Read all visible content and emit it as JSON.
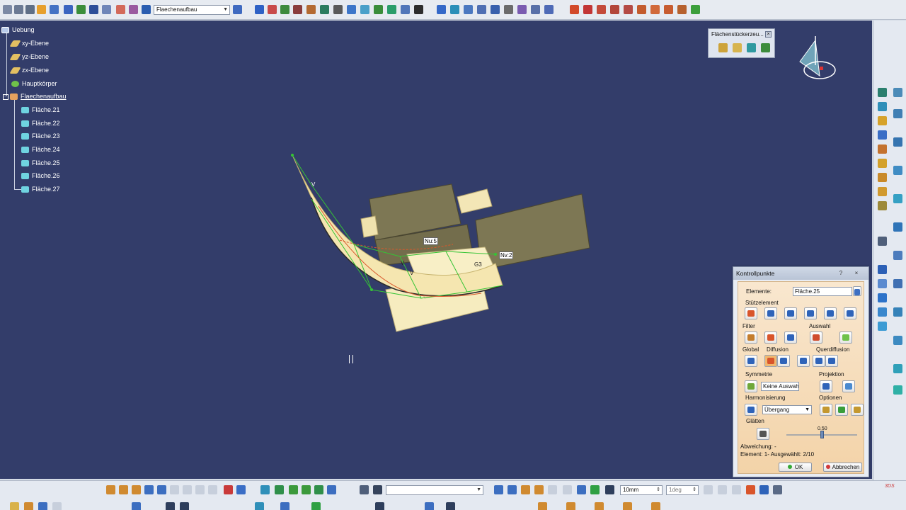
{
  "top_toolbar": {
    "workbench_combo": "Flaechenaufbau"
  },
  "tree": {
    "root": "Uebung",
    "items": [
      {
        "label": "xy-Ebene",
        "icon": "plane-icon"
      },
      {
        "label": "yz-Ebene",
        "icon": "plane-icon"
      },
      {
        "label": "zx-Ebene",
        "icon": "plane-icon"
      },
      {
        "label": "Hauptkörper",
        "icon": "gear-body-icon"
      },
      {
        "label": "Flaechenaufbau",
        "icon": "geometrical-set-icon"
      }
    ],
    "children": [
      {
        "label": "Fläche.21"
      },
      {
        "label": "Fläche.22"
      },
      {
        "label": "Fläche.23"
      },
      {
        "label": "Fläche.24"
      },
      {
        "label": "Fläche.25"
      },
      {
        "label": "Fläche.26"
      },
      {
        "label": "Fläche.27"
      }
    ]
  },
  "floating_toolbar": {
    "title": "Flächenstückerzeu..."
  },
  "viewport_labels": {
    "nu": "Nu:5",
    "nv": "Nv:2",
    "g3": "G3",
    "v1": "V",
    "v2": "V",
    "v3": "V"
  },
  "dialog": {
    "title": "Kontrollpunkte",
    "help": "?",
    "close": "×",
    "elemente_label": "Elemente:",
    "elemente_value": "Fläche.25",
    "stuetzelement": "Stützelement",
    "filter": "Filter",
    "auswahl": "Auswahl",
    "global": "Global",
    "diffusion": "Diffusion",
    "querdiffusion": "Querdiffusion",
    "symmetrie": "Symmetrie",
    "symmetrie_value": "Keine Auswahl",
    "projektion": "Projektion",
    "harmonisierung": "Harmonisierung",
    "harmonisierung_value": "Übergang",
    "optionen": "Optionen",
    "glaetten": "Glätten",
    "slider_value": "0.50",
    "slider_level": 0.5,
    "abweichung": "Abweichung: -",
    "element_info": "Element: 1- Ausgewählt: 2/10",
    "ok": "OK",
    "cancel": "Abbrechen"
  },
  "bottom_toolbar": {
    "combo_empty": "",
    "length_value": "10mm",
    "angle_value": "1deg"
  },
  "colors": {
    "viewport_bg": "#333d6a",
    "surface_yellow": "#f6ecbf",
    "dark_panel": "#7d7754",
    "dialog_bg": "#f5dcb6"
  }
}
